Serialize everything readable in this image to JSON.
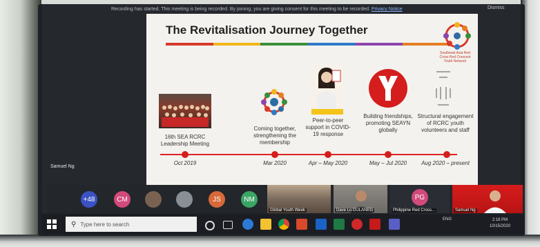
{
  "notice": {
    "text": "Recording has started. This meeting is being recorded. By joining, you are giving consent for this meeting to be recorded.",
    "link": "Privacy Notice"
  },
  "top_right_button": "Dismiss",
  "slide": {
    "title": "The Revitalisation Journey Together",
    "rule_colors": [
      "#d83a2b",
      "#f2b51b",
      "#3a8f3a",
      "#2f79c8",
      "#8e44ad",
      "#e67e22"
    ],
    "logo_text": "Southeast Asia Red Cross Red Crescent Youth Network",
    "milestones": [
      {
        "text": "16th SEA RCRC Leadership Meeting",
        "date": "Oct 2019"
      },
      {
        "text": "Coming together, strengthening the membership",
        "date": "Mar 2020"
      },
      {
        "text": "Peer-to-peer support in COVID-19 response",
        "date": "Apr – May 2020"
      },
      {
        "text": "Building friendships, promoting SEAYN globally",
        "date": "May – Jul 2020"
      },
      {
        "text": "Structural engagement of RCRC youth volunteers and staff",
        "date": "Aug 2020 – present"
      }
    ]
  },
  "active_speaker": "Samuel Ng",
  "gallery": {
    "avatars": [
      {
        "initials": "+48",
        "color": "#3a52c4"
      },
      {
        "initials": "CM",
        "color": "#d24a7a"
      },
      {
        "initials": "",
        "color": "#7a6252"
      },
      {
        "initials": "",
        "color": "#8a8f96"
      },
      {
        "initials": "JS",
        "color": "#d86a3a"
      },
      {
        "initials": "NM",
        "color": "#3aa564"
      }
    ],
    "tiles": [
      {
        "name": "Global Youth Week"
      },
      {
        "name": "Dave Lo DULANEG"
      },
      {
        "name": "Philippine Red Cross..."
      },
      {
        "name": "Samuel Ng"
      }
    ],
    "pg_initials": "PG",
    "pg_color": "#d24a7a"
  },
  "taskbar": {
    "search_placeholder": "Type here to search",
    "time": "2:18 PM",
    "date": "10/15/2020",
    "tray_text": "ENG"
  }
}
